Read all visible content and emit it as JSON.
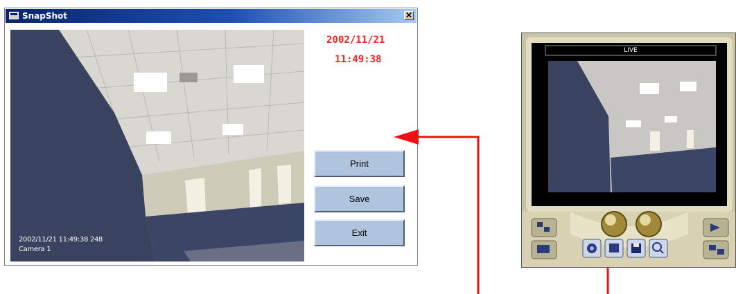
{
  "dialog": {
    "title": "SnapShot",
    "close_glyph": "✕",
    "timestamp_date": "2002/11/21",
    "timestamp_time": "11:49:38",
    "overlay_datetime": "2002/11/21 11:49:38 248",
    "overlay_camera": "Camera 1",
    "buttons": {
      "print": "Print",
      "save": "Save",
      "exit": "Exit"
    }
  },
  "viewer": {
    "status_label": "LIVE"
  },
  "colors": {
    "timestamp": "#ff2020",
    "arrow": "#ee1111",
    "button_face": "#b0c4de",
    "title_bar": "#0a246a"
  },
  "icons": [
    "window-icon",
    "close-icon",
    "layout-icon",
    "camera-record-icon",
    "snapshot-icon",
    "image-icon",
    "save-disk-icon",
    "zoom-icon",
    "next-camera-icon",
    "swap-icon"
  ]
}
